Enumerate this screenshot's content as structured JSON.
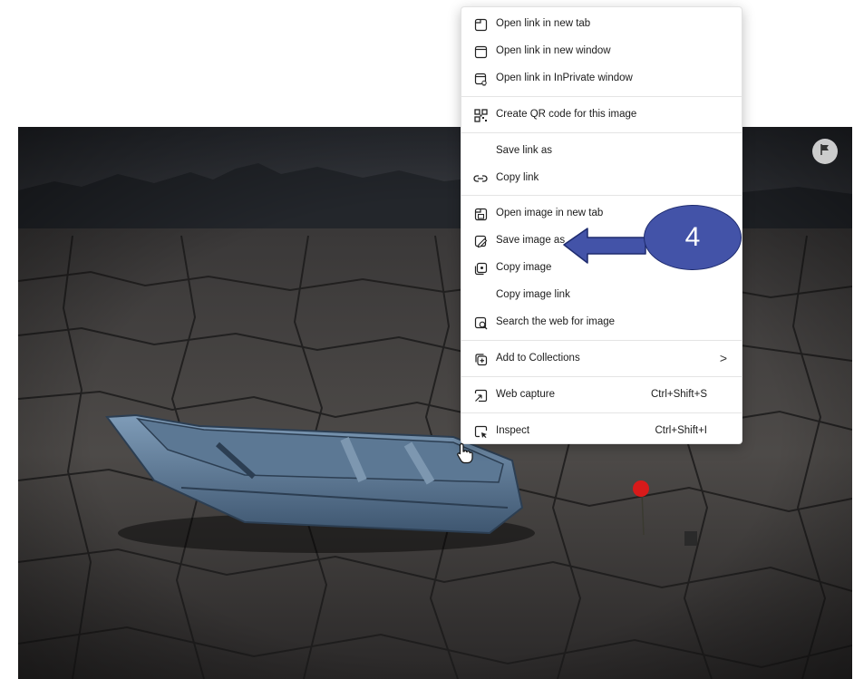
{
  "menu": {
    "items": [
      {
        "label": "Open link in new tab",
        "icon": "new-tab-icon"
      },
      {
        "label": "Open link in new window",
        "icon": "new-window-icon"
      },
      {
        "label": "Open link in InPrivate window",
        "icon": "inprivate-window-icon"
      },
      {
        "label": "Create QR code for this image",
        "icon": "qr-code-icon"
      },
      {
        "label": "Save link as",
        "icon": ""
      },
      {
        "label": "Copy link",
        "icon": "link-icon"
      },
      {
        "label": "Open image in new tab",
        "icon": "image-new-tab-icon"
      },
      {
        "label": "Save image as",
        "icon": "save-image-icon"
      },
      {
        "label": "Copy image",
        "icon": "copy-image-icon"
      },
      {
        "label": "Copy image link",
        "icon": ""
      },
      {
        "label": "Search the web for image",
        "icon": "image-search-icon"
      },
      {
        "label": "Add to Collections",
        "icon": "collections-icon",
        "submenu_glyph": ">"
      },
      {
        "label": "Web capture",
        "icon": "web-capture-icon",
        "shortcut": "Ctrl+Shift+S"
      },
      {
        "label": "Inspect",
        "icon": "inspect-icon",
        "shortcut": "Ctrl+Shift+I"
      }
    ]
  },
  "annotation": {
    "step_number": "4",
    "color": "#4353a8"
  },
  "photo": {
    "flag_icon": "flag-icon"
  }
}
